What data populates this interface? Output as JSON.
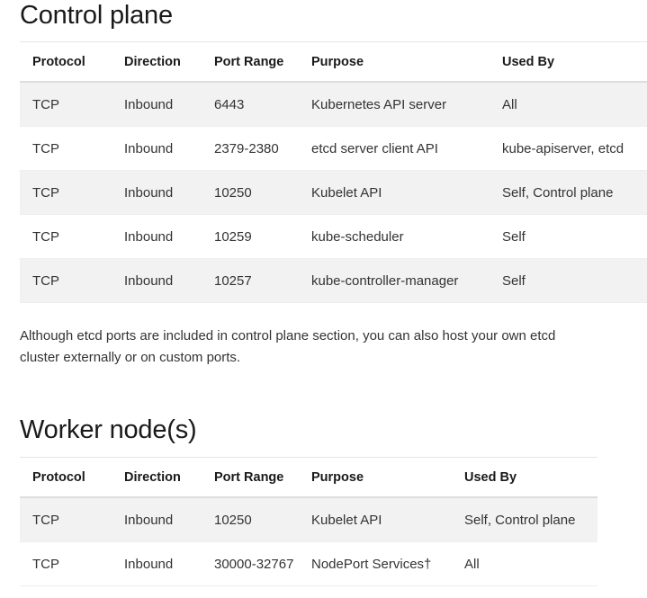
{
  "sections": [
    {
      "id": "control-plane",
      "heading": "Control plane",
      "table": {
        "columns": [
          "Protocol",
          "Direction",
          "Port Range",
          "Purpose",
          "Used By"
        ],
        "rows": [
          [
            "TCP",
            "Inbound",
            "6443",
            "Kubernetes API server",
            "All"
          ],
          [
            "TCP",
            "Inbound",
            "2379-2380",
            "etcd server client API",
            "kube-apiserver, etcd"
          ],
          [
            "TCP",
            "Inbound",
            "10250",
            "Kubelet API",
            "Self, Control plane"
          ],
          [
            "TCP",
            "Inbound",
            "10259",
            "kube-scheduler",
            "Self"
          ],
          [
            "TCP",
            "Inbound",
            "10257",
            "kube-controller-manager",
            "Self"
          ]
        ]
      },
      "note": "Although etcd ports are included in control plane section, you can also host your own etcd cluster externally or on custom ports."
    },
    {
      "id": "worker-nodes",
      "heading": "Worker node(s)",
      "table": {
        "columns": [
          "Protocol",
          "Direction",
          "Port Range",
          "Purpose",
          "Used By"
        ],
        "rows": [
          [
            "TCP",
            "Inbound",
            "10250",
            "Kubelet API",
            "Self, Control plane"
          ],
          [
            "TCP",
            "Inbound",
            "30000-32767",
            "NodePort Services†",
            "All"
          ]
        ]
      }
    }
  ],
  "colors": {
    "page_background": "#ffffff",
    "text": "#333333",
    "heading_text": "#1a1a1a",
    "row_stripe": "#f2f2f2",
    "row_border": "#eeeeee",
    "header_border": "#dddddd",
    "table_top_border": "#e6e6e6"
  }
}
